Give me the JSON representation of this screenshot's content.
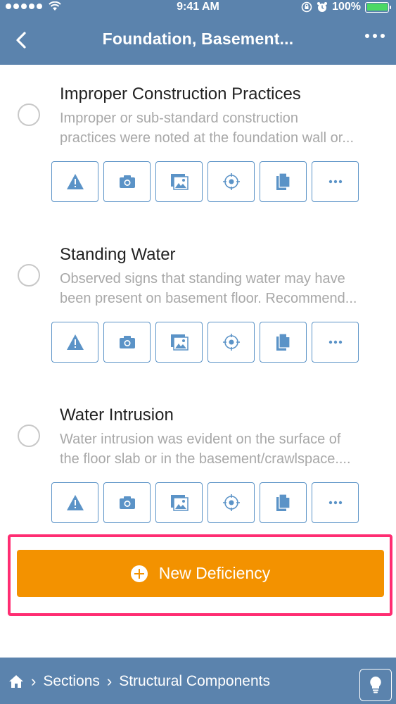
{
  "status_bar": {
    "time": "9:41 AM",
    "battery": "100%"
  },
  "nav": {
    "title": "Foundation, Basement...",
    "back_icon": "chevron-left-icon",
    "menu_icon": "more-horizontal-icon"
  },
  "items": [
    {
      "title": "Improper Construction Practices",
      "desc_line1": "Improper or sub-standard construction",
      "desc_line2": "practices were noted at the foundation wall or..."
    },
    {
      "title": "Standing Water",
      "desc_line1": "Observed signs that standing water may have",
      "desc_line2": "been present on basement floor. Recommend..."
    },
    {
      "title": "Water Intrusion",
      "desc_line1": "Water intrusion was evident on the surface of",
      "desc_line2": "the floor slab or in the basement/crawlspace...."
    }
  ],
  "action_icons": [
    "warning-icon",
    "camera-icon",
    "gallery-icon",
    "target-icon",
    "document-icon",
    "more-icon"
  ],
  "new_deficiency": {
    "label": "New Deficiency",
    "icon": "plus-circle-icon",
    "highlight_color": "#ff2d72",
    "button_color": "#f39200"
  },
  "breadcrumb": {
    "home_icon": "home-icon",
    "items": [
      "Sections",
      "Structural Components"
    ],
    "tip_icon": "lightbulb-icon"
  },
  "colors": {
    "brand_blue": "#5b83ad",
    "action_border": "#5b93c7",
    "battery_green": "#4cd964"
  }
}
